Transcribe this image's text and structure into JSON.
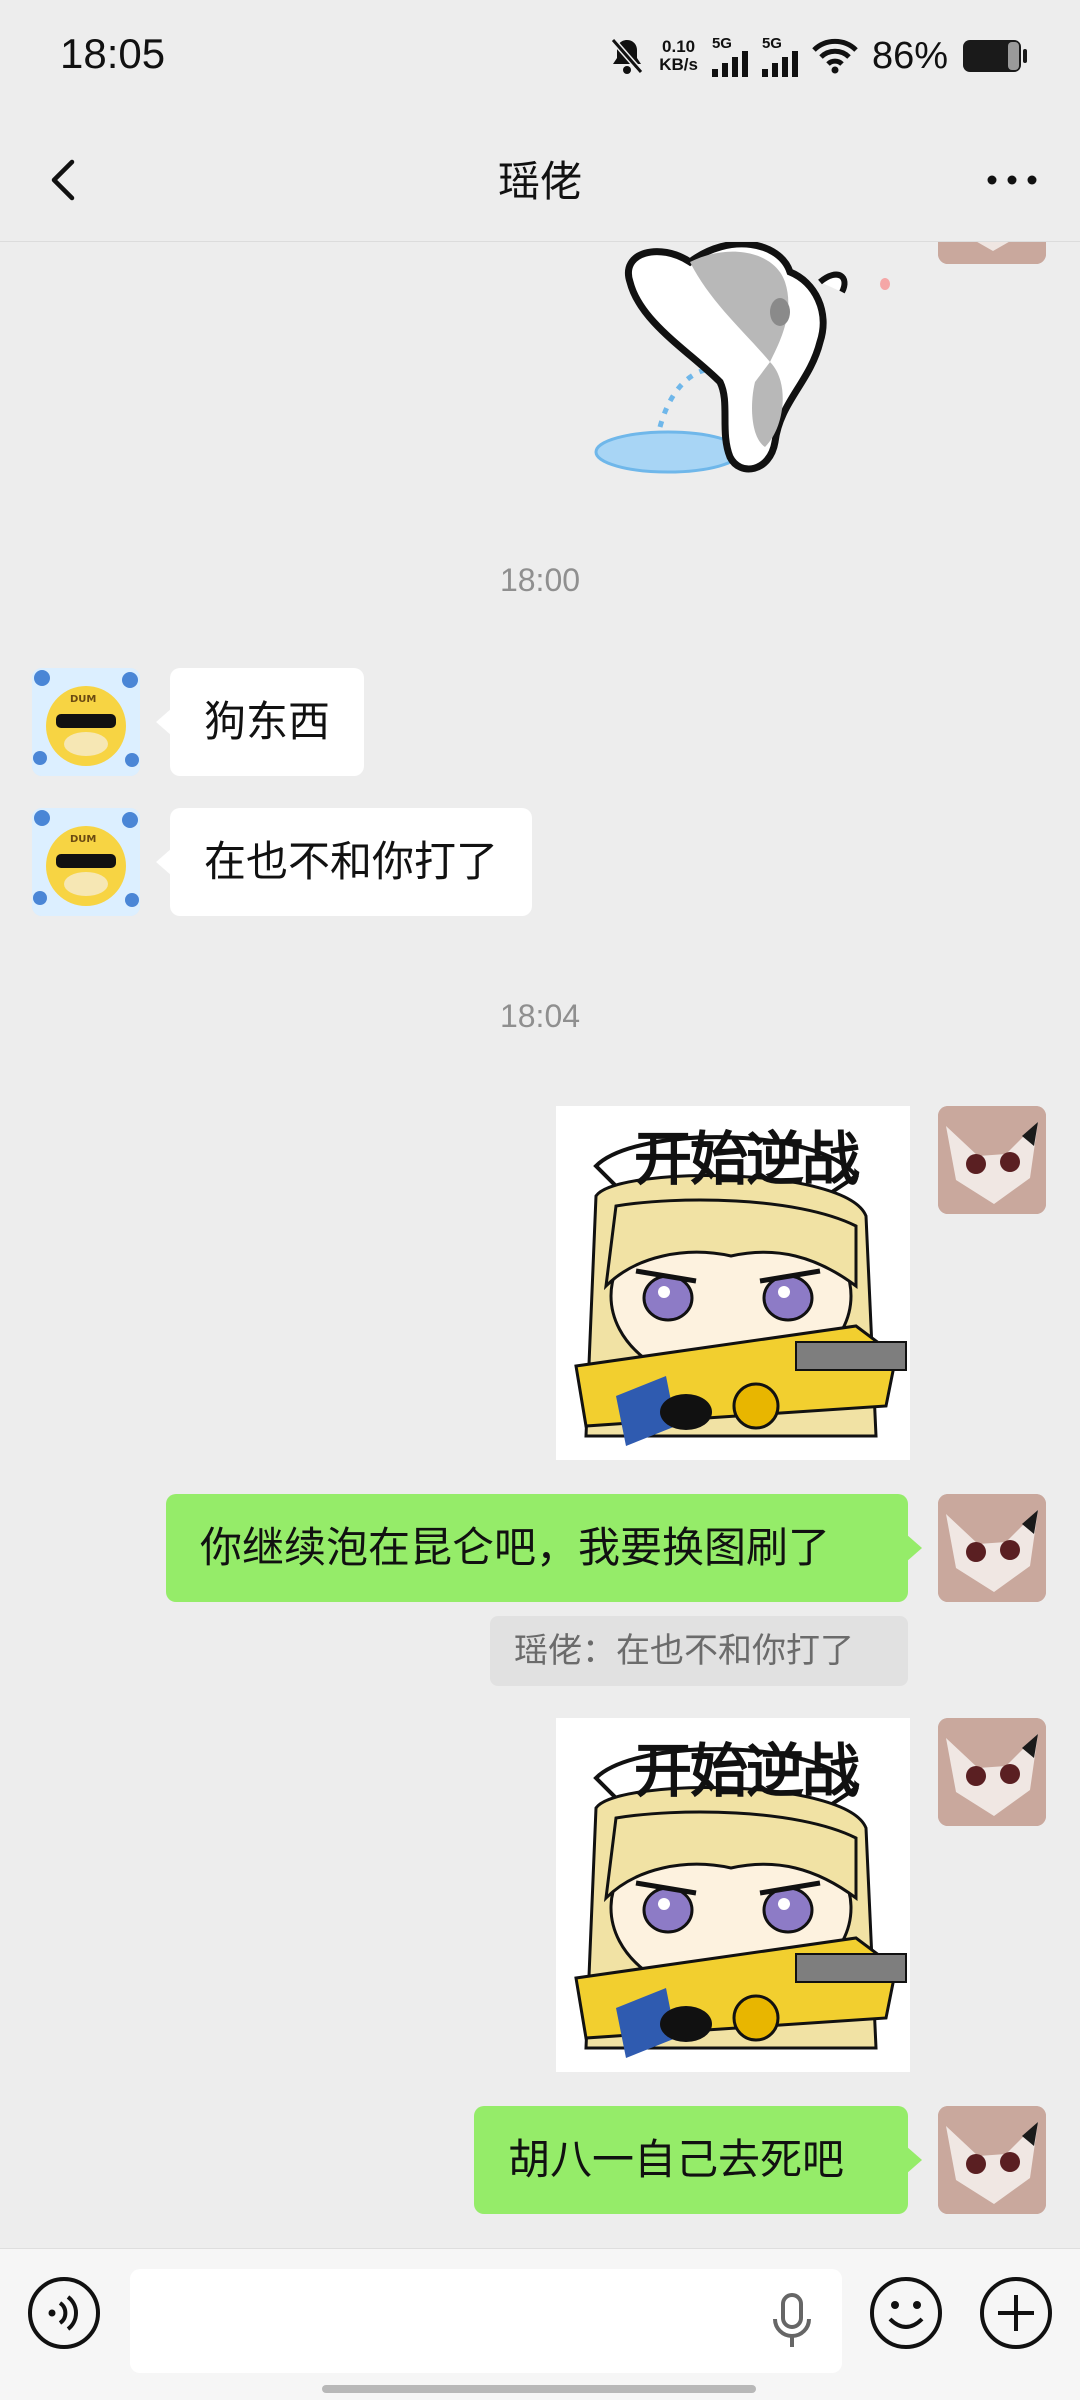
{
  "status_bar": {
    "time": "18:05",
    "net_speed_value": "0.10",
    "net_speed_unit": "KB/s",
    "signal1": "5G",
    "signal2": "5G",
    "battery": "86%"
  },
  "header": {
    "title": "瑶佬",
    "back_icon": "chevron-left-icon",
    "more_icon": "more-dots-icon"
  },
  "messages": {
    "ts1": "18:00",
    "msg1": "狗东西",
    "msg2": "在也不和你打了",
    "ts2": "18:04",
    "sticker_caption_1": "开始逆战",
    "msg3": "你继续泡在昆仑吧，我要换图刷了",
    "quote3": "瑶佬：在也不和你打了",
    "sticker_caption_2": "开始逆战",
    "msg4": "胡八一自己去死吧"
  },
  "input_bar": {
    "voice_icon": "voice-icon",
    "mic_icon": "mic-icon",
    "emoji_icon": "emoji-icon",
    "plus_icon": "plus-icon",
    "placeholder": ""
  },
  "colors": {
    "background": "#ededed",
    "own_bubble": "#95ec69",
    "peer_bubble": "#ffffff"
  }
}
